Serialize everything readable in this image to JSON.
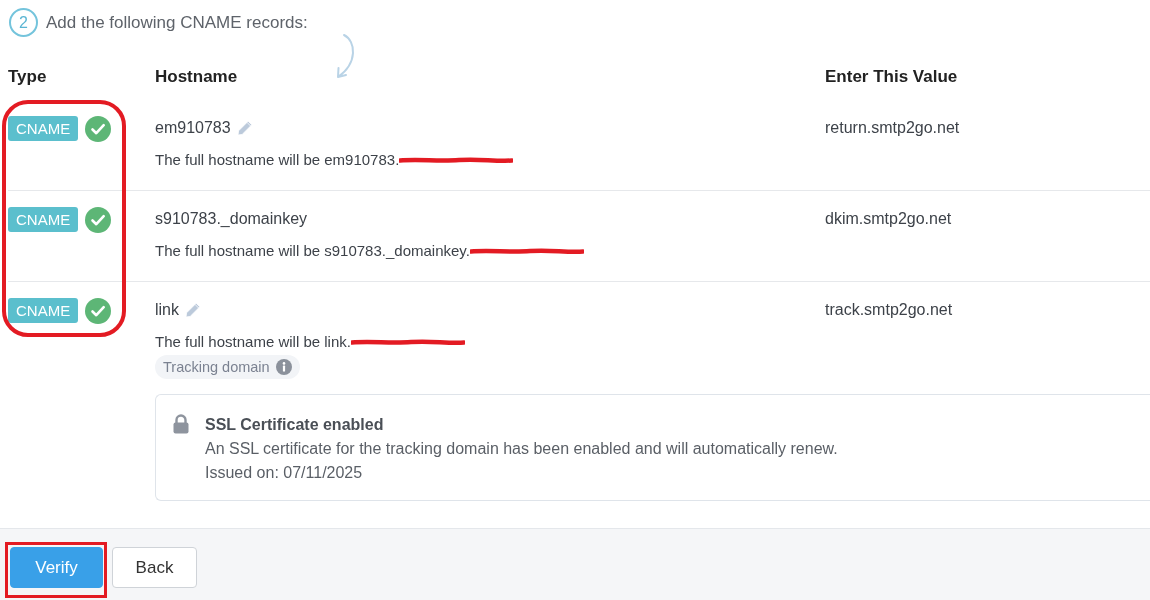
{
  "step": {
    "number": "2",
    "title": "Add the following CNAME records:"
  },
  "table": {
    "columns": [
      "Type",
      "Hostname",
      "Enter This Value"
    ],
    "type_column_highlighted": true,
    "rows": [
      {
        "type": "CNAME",
        "verified": true,
        "hostname": "em910783",
        "editable": true,
        "full_hostname": "The full hostname will be em910783.",
        "redacted": true,
        "value": "return.smtp2go.net"
      },
      {
        "type": "CNAME",
        "verified": true,
        "hostname": "s910783._domainkey",
        "editable": false,
        "full_hostname": "The full hostname will be s910783._domainkey.",
        "redacted": true,
        "value": "dkim.smtp2go.net"
      },
      {
        "type": "CNAME",
        "verified": true,
        "hostname": "link",
        "editable": true,
        "full_hostname": "The full hostname will be link.",
        "redacted": true,
        "value": "track.smtp2go.net",
        "tag": "Tracking domain",
        "ssl": {
          "title": "SSL Certificate enabled",
          "description": "An SSL certificate for the tracking domain has been enabled and will automatically renew.",
          "issued": "Issued on: 07/11/2025"
        }
      }
    ]
  },
  "buttons": [
    {
      "label": "Verify",
      "kind": "primary",
      "highlighted": true
    },
    {
      "label": "Back",
      "kind": "default",
      "highlighted": false
    }
  ]
}
